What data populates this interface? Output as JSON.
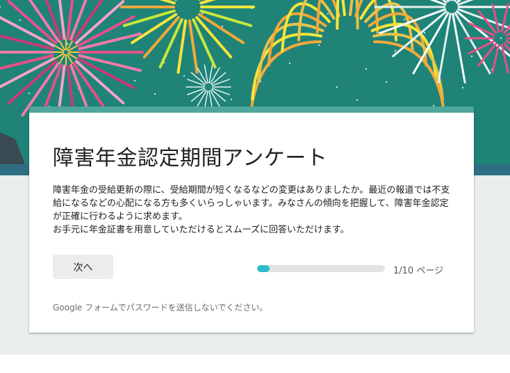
{
  "form": {
    "title": "障害年金認定期間アンケート",
    "description": "障害年金の受給更新の際に、受給期間が短くなるなどの変更はありましたか。最近の報道では不支\n給になるなどの心配になる方も多くいらっしゃいます。みなさんの傾向を把握して、障害年金認定\nが正確に行わるように求めます。\nお手元に年金証書を用意していただけるとスムーズに回答いただけます。",
    "next_label": "次へ",
    "progress_fraction": 0.1,
    "progress_label": "1/10 ページ",
    "footer_note": "Google フォームでパスワードを送信しないでください。"
  },
  "colors": {
    "header_bg": "#1f8378",
    "card_accent": "#4fa79b",
    "progress_fill": "#2bbcc8",
    "page_bg": "#e8efee"
  },
  "icons": {
    "header": "fireworks-illustration"
  }
}
